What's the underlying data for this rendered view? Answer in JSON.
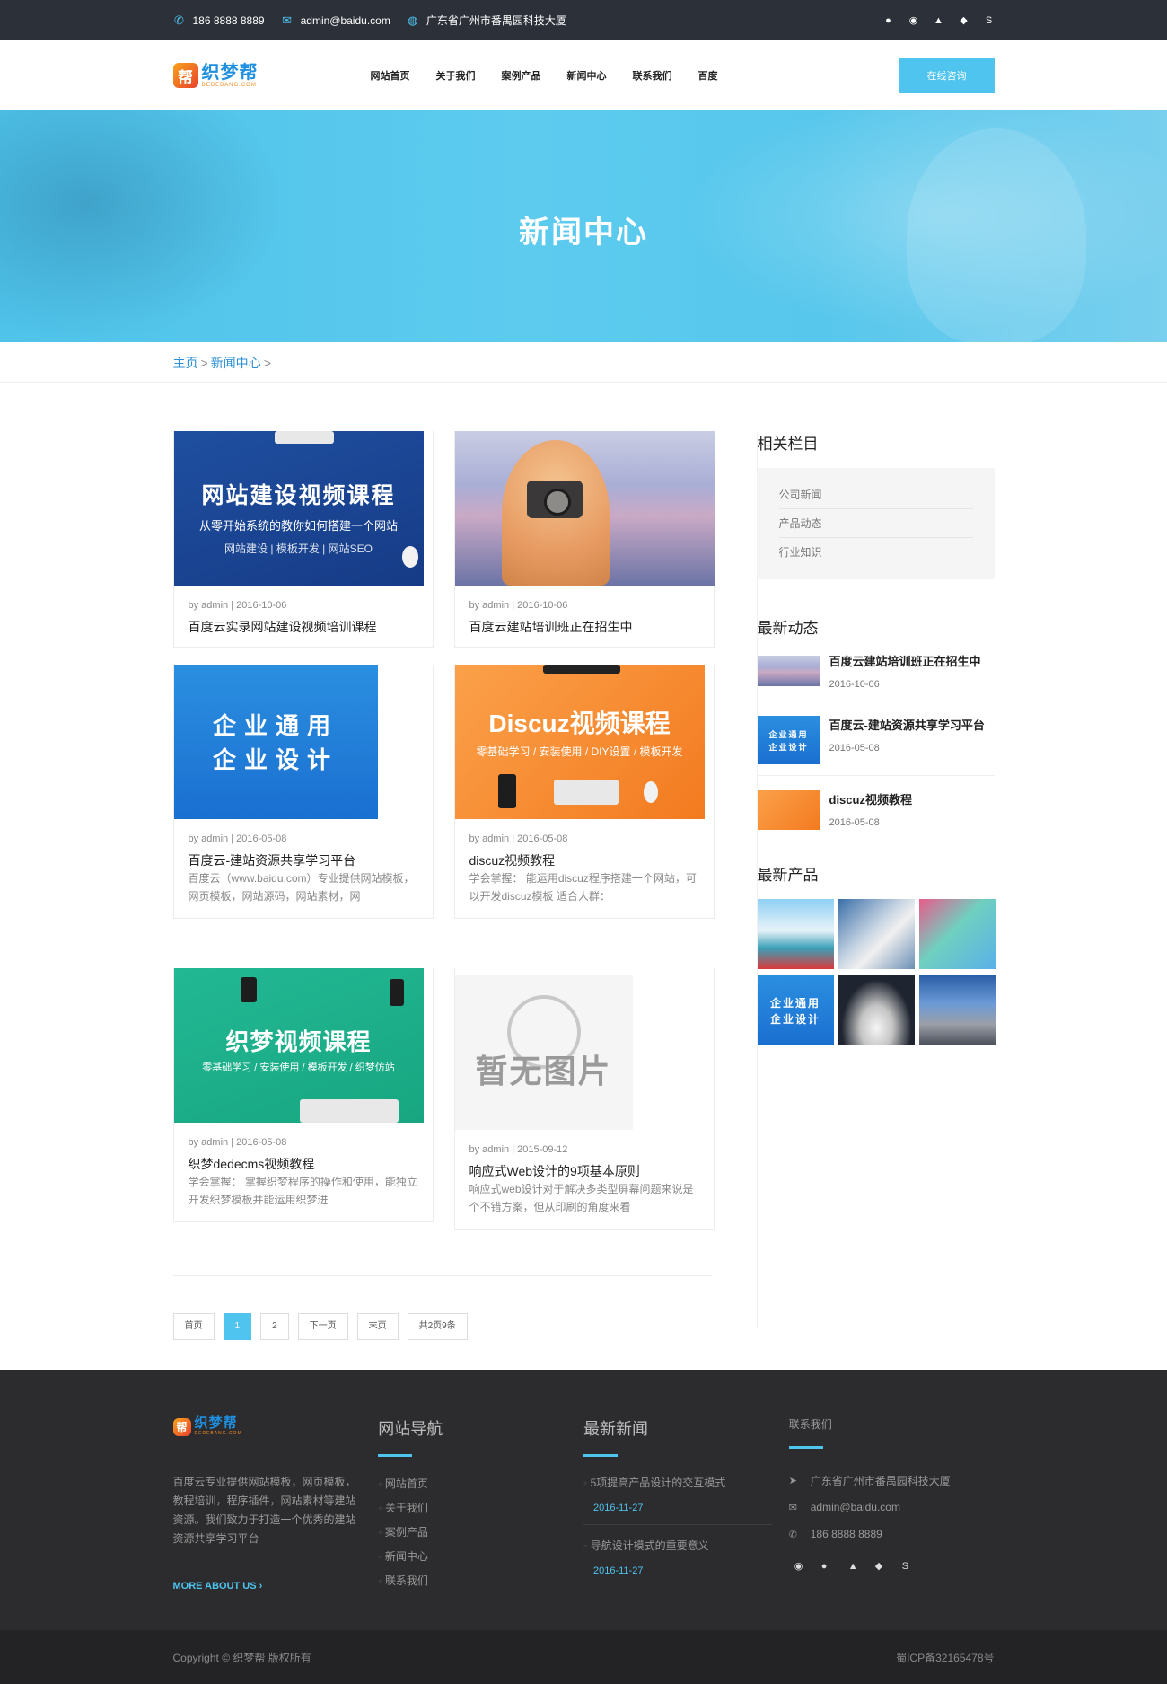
{
  "topbar": {
    "phone": "186 8888 8889",
    "email": "admin@baidu.com",
    "address": "广东省广州市番禺园科技大厦",
    "social_icons": [
      "wechat-icon",
      "weibo-icon",
      "qq-icon",
      "chat-icon",
      "skype-icon"
    ]
  },
  "header": {
    "logo_text": "织梦帮",
    "logo_sub": "DEDEBANG.COM",
    "nav": [
      "网站首页",
      "关于我们",
      "案例产品",
      "新闻中心",
      "联系我们",
      "百度"
    ],
    "consult_label": "在线咨询"
  },
  "banner": {
    "title": "新闻中心"
  },
  "breadcrumb": {
    "home": "主页",
    "sep": ">",
    "current": "新闻中心"
  },
  "articles": [
    {
      "thumb": {
        "type": "blue",
        "heading": "网站建设视频课程",
        "sub1": "从零开始系统的教你如何搭建一个网站",
        "sub2": "网站建设 | 模板开发 | 网站SEO"
      },
      "meta": "by admin | 2016-10-06",
      "title": "百度云实录网站建设视频培训课程",
      "desc": ""
    },
    {
      "thumb": {
        "type": "photo"
      },
      "meta": "by admin | 2016-10-06",
      "title": "百度云建站培训班正在招生中",
      "desc": ""
    },
    {
      "thumb": {
        "type": "ent",
        "heading1": "企业通用",
        "heading2": "企业设计"
      },
      "meta": "by admin | 2016-05-08",
      "title": "百度云-建站资源共享学习平台",
      "desc": "百度云（www.baidu.com）专业提供网站模板，网页模板，网站源码，网站素材，网"
    },
    {
      "thumb": {
        "type": "orange",
        "heading": "Discuz视频课程",
        "sub1": "零基础学习 / 安装使用 / DIY设置 / 模板开发"
      },
      "meta": "by admin | 2016-05-08",
      "title": "discuz视频教程",
      "desc": "学会掌握： 能运用discuz程序搭建一个网站，可以开发discuz模板 适合人群："
    },
    {
      "thumb": {
        "type": "green",
        "heading": "织梦视频课程",
        "sub1": "零基础学习 / 安装使用 / 模板开发 / 织梦仿站"
      },
      "meta": "by admin | 2016-05-08",
      "title": "织梦dedecms视频教程",
      "desc": "学会掌握： 掌握织梦程序的操作和使用，能独立开发织梦模板并能运用织梦进"
    },
    {
      "thumb": {
        "type": "none",
        "heading": "暂无图片"
      },
      "meta": "by admin | 2015-09-12",
      "title": "响应式Web设计的9项基本原则",
      "desc": "响应式web设计对于解决多类型屏幕问题来说是个不错方案，但从印刷的角度来看"
    }
  ],
  "pagination": [
    "首页",
    "1",
    "2",
    "下一页",
    "末页",
    "共2页9条"
  ],
  "sidebar": {
    "related_title": "相关栏目",
    "categories": [
      "公司新闻",
      "产品动态",
      "行业知识"
    ],
    "latest_title": "最新动态",
    "latest": [
      {
        "title": "百度云建站培训班正在招生中",
        "date": "2016-10-06",
        "thumb": "photo"
      },
      {
        "title": "百度云-建站资源共享学习平台",
        "date": "2016-05-08",
        "thumb": "ent"
      },
      {
        "title": "discuz视频教程",
        "date": "2016-05-08",
        "thumb": "orange"
      }
    ],
    "products_title": "最新产品",
    "product_ent_text1": "企业通用",
    "product_ent_text2": "企业设计"
  },
  "footer": {
    "about": "百度云专业提供网站模板，网页模板，教程培训，程序插件，网站素材等建站资源。我们致力于打造一个优秀的建站资源共享学习平台",
    "more_label": "MORE ABOUT US",
    "nav_title": "网站导航",
    "nav_links": [
      "网站首页",
      "关于我们",
      "案例产品",
      "新闻中心",
      "联系我们"
    ],
    "news_title": "最新新闻",
    "news": [
      {
        "title": "5项提高产品设计的交互模式",
        "date": "2016-11-27"
      },
      {
        "title": "导航设计模式的重要意义",
        "date": "2016-11-27"
      }
    ],
    "contact_title": "联系我们",
    "contact_address": "广东省广州市番禺园科技大厦",
    "contact_email": "admin@baidu.com",
    "contact_phone": "186 8888 8889"
  },
  "copyright": {
    "text": "Copyright © 织梦帮 版权所有",
    "icp": "蜀ICP备32165478号"
  },
  "colors": {
    "accent": "#4fc4ee",
    "topbar": "#2c3038",
    "footer": "#2c2c2e"
  }
}
